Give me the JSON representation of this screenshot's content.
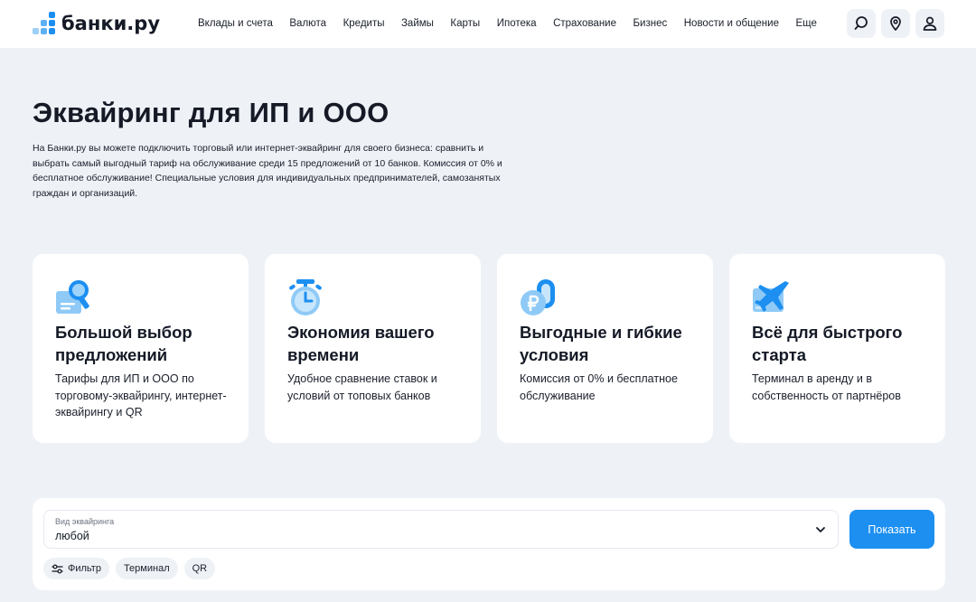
{
  "header": {
    "logo_text": "банки.ру",
    "nav": [
      "Вклады и счета",
      "Валюта",
      "Кредиты",
      "Займы",
      "Карты",
      "Ипотека",
      "Страхование",
      "Бизнес",
      "Новости и общение",
      "Еще"
    ],
    "icons": [
      "search-icon",
      "location-pin-icon",
      "user-icon"
    ]
  },
  "main": {
    "title": "Эквайринг для ИП и ООО",
    "description": "На Банки.ру вы можете подключить торговый или интернет-эквайринг для своего бизнеса: сравнить и выбрать самый выгодный тариф на обслуживание среди 15 предложений от 10 банков. Комиссия от 0% и бесплатное обслуживание! Специальные условия для индивидуальных предпринимателей, самозанятых граждан и организаций."
  },
  "features": [
    {
      "title": "Большой выбор предложений",
      "text": "Тарифы для ИП и ООО по торговому-эквайрингу, интернет-эквайрингу и QR",
      "icon": "document-magnifier-icon"
    },
    {
      "title": "Экономия вашего времени",
      "text": "Удобное сравнение ставок и условий от топовых банков",
      "icon": "stopwatch-icon"
    },
    {
      "title": "Выгодные и гибкие условия",
      "text": "Комиссия от 0% и бесплатное обслуживание",
      "icon": "ruble-coins-icon"
    },
    {
      "title": "Всё для быстрого старта",
      "text": "Терминал в аренду и в собственность от партнёров",
      "icon": "airplane-icon"
    }
  ],
  "filter": {
    "select_label": "Вид эквайринга",
    "select_value": "любой",
    "show_button": "Показать",
    "chips": [
      "Фильтр",
      "Терминал",
      "QR"
    ]
  },
  "colors": {
    "accent": "#1c8ff1",
    "background": "#eef1f6",
    "card": "#ffffff",
    "text": "#151a26"
  }
}
